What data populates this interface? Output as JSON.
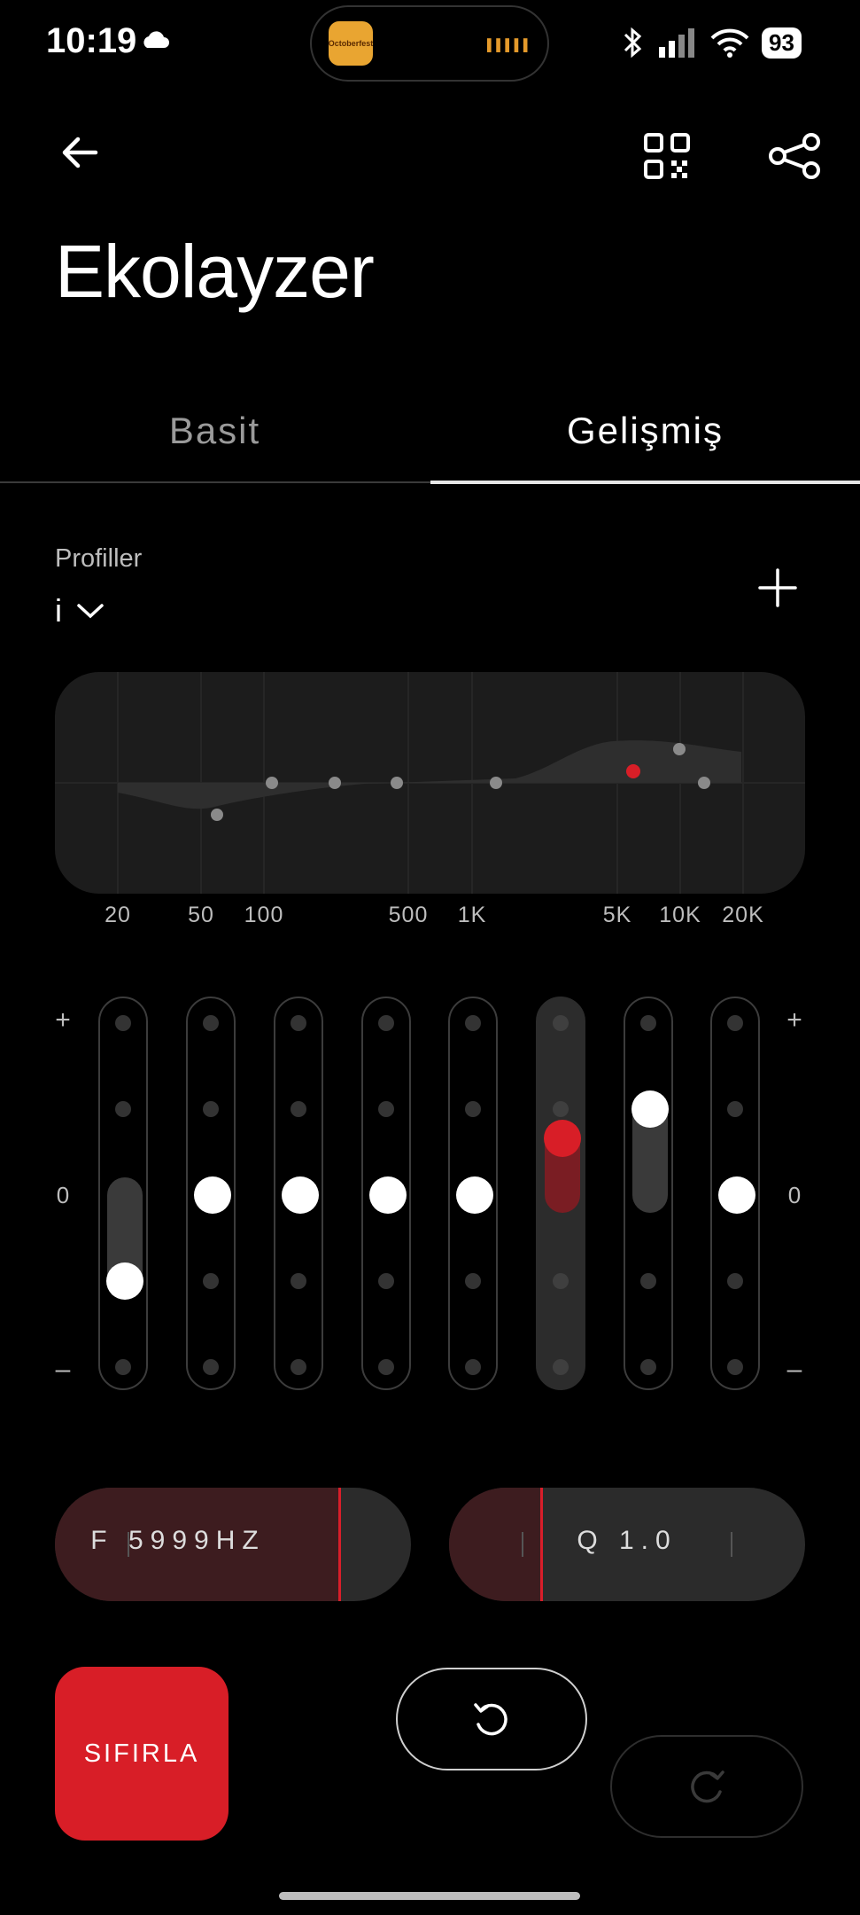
{
  "status_bar": {
    "time": "10:19",
    "battery": "93",
    "island_app_label": "Octoberfest"
  },
  "header": {
    "title": "Ekolayzer",
    "back_icon": "arrow-left-icon",
    "qr_icon": "qr-code-icon",
    "share_icon": "share-icon"
  },
  "tabs": [
    {
      "label": "Basit",
      "active": false
    },
    {
      "label": "Gelişmiş",
      "active": true
    }
  ],
  "profiles": {
    "label": "Profiller",
    "selected": "i",
    "add_icon": "plus-icon"
  },
  "graph": {
    "freq_labels": [
      "20",
      "50",
      "100",
      "500",
      "1K",
      "5K",
      "10K",
      "20K"
    ]
  },
  "sliders": {
    "plus_sign": "+",
    "zero_label": "0",
    "minus_sign": "–",
    "bands": [
      {
        "level": -0.5,
        "active": false
      },
      {
        "level": 0,
        "active": false
      },
      {
        "level": 0,
        "active": false
      },
      {
        "level": 0,
        "active": false
      },
      {
        "level": 0,
        "active": false
      },
      {
        "level": 0.33,
        "active": true
      },
      {
        "level": 0.5,
        "active": false
      },
      {
        "level": 0,
        "active": false
      }
    ]
  },
  "params": {
    "frequency": "F 5999HZ",
    "q": "Q 1.0"
  },
  "buttons": {
    "reset": "SIFIRLA",
    "undo_icon": "undo-icon",
    "redo_icon": "redo-icon"
  },
  "colors": {
    "accent": "#d81e27",
    "background": "#000000"
  }
}
